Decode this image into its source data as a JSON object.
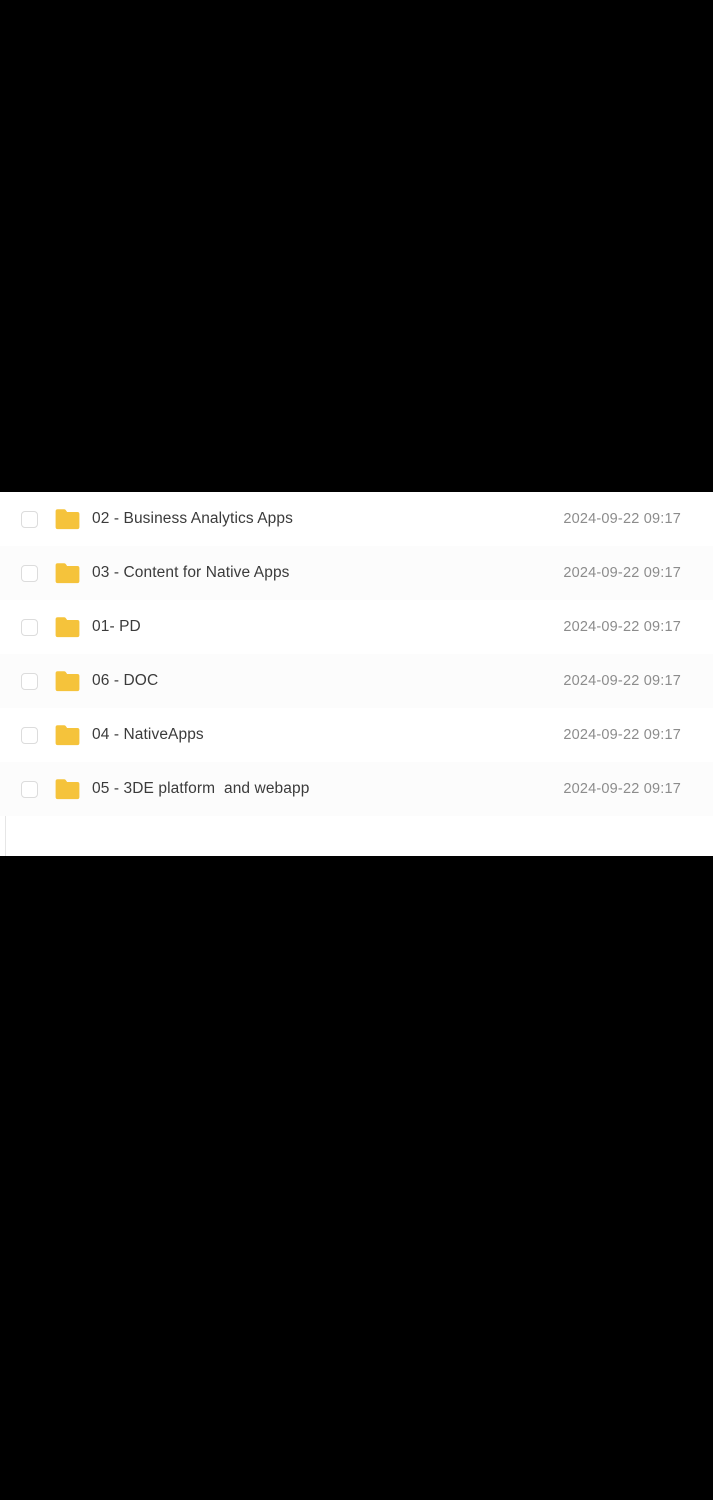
{
  "window": {
    "background_color": "#000000",
    "panel_background_color": "#ffffff"
  },
  "file_list": {
    "icon": "folder-icon",
    "folder_color": "#F5C33B",
    "checkbox_state": "unchecked",
    "date_text_color": "#8c8c8c",
    "name_text_color": "#3b3b3b",
    "rows": [
      {
        "name": "02 - Business Analytics Apps",
        "date": "2024-09-22 09:17"
      },
      {
        "name": "03 - Content for Native Apps",
        "date": "2024-09-22 09:17"
      },
      {
        "name": "01- PD",
        "date": "2024-09-22 09:17"
      },
      {
        "name": "06 - DOC",
        "date": "2024-09-22 09:17"
      },
      {
        "name": "04 - NativeApps",
        "date": "2024-09-22 09:17"
      },
      {
        "name": "05 - 3DE platform  and webapp",
        "date": "2024-09-22 09:17"
      }
    ]
  }
}
